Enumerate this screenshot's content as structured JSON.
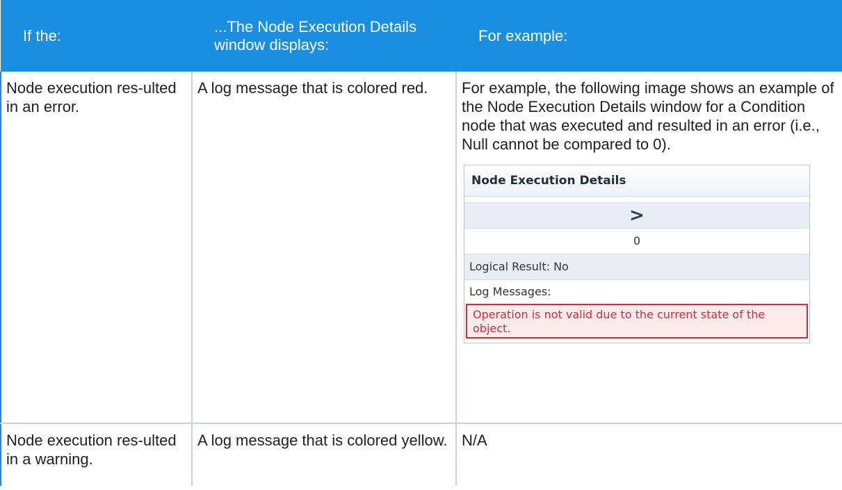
{
  "table": {
    "headers": [
      "If the:",
      "...The Node Execution Details window displays:",
      "For example:"
    ],
    "rows": [
      {
        "condition": "Node execution res-ulted in an error.",
        "display": "A log message that is colored red.",
        "example": "For example, the following image shows an example of the Node Execution Details window for a Condition node that was executed and resulted in an error (i.e., Null cannot be compared to 0)."
      },
      {
        "condition": "Node execution res-ulted in a warning.",
        "display": "A log message that is colored yellow.",
        "example": "N/A"
      }
    ]
  },
  "dialog": {
    "title": "Node Execution Details",
    "operator": ">",
    "value": "0",
    "logical_result": "Logical Result: No",
    "log_messages_label": "Log Messages:",
    "error_message": "Operation is not valid due to the current state of the object."
  },
  "colors": {
    "header_bg": "#1a8ee1",
    "header_text": "#ffffff",
    "error_text": "#c8303b",
    "error_border": "#c8303b"
  }
}
